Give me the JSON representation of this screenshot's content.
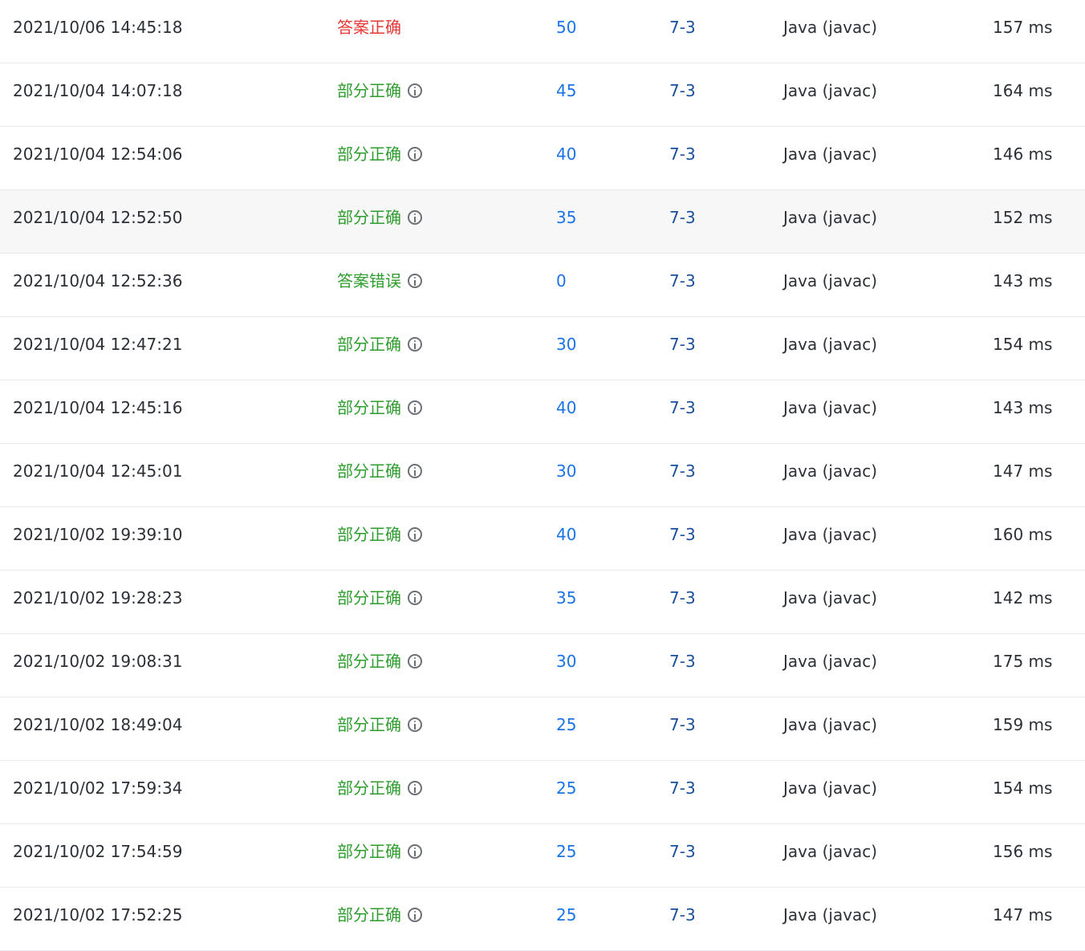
{
  "submissions": [
    {
      "submitted": "2021/10/06 14:45:18",
      "status": "答案正确",
      "status_type": "ok",
      "score": "50",
      "problem": "7-3",
      "language": "Java (javac)",
      "runtime": "157 ms"
    },
    {
      "submitted": "2021/10/04 14:07:18",
      "status": "部分正确",
      "status_type": "partial",
      "score": "45",
      "problem": "7-3",
      "language": "Java (javac)",
      "runtime": "164 ms"
    },
    {
      "submitted": "2021/10/04 12:54:06",
      "status": "部分正确",
      "status_type": "partial",
      "score": "40",
      "problem": "7-3",
      "language": "Java (javac)",
      "runtime": "146 ms"
    },
    {
      "submitted": "2021/10/04 12:52:50",
      "status": "部分正确",
      "status_type": "partial",
      "score": "35",
      "problem": "7-3",
      "language": "Java (javac)",
      "runtime": "152 ms"
    },
    {
      "submitted": "2021/10/04 12:52:36",
      "status": "答案错误",
      "status_type": "wrong",
      "score": "0",
      "problem": "7-3",
      "language": "Java (javac)",
      "runtime": "143 ms"
    },
    {
      "submitted": "2021/10/04 12:47:21",
      "status": "部分正确",
      "status_type": "partial",
      "score": "30",
      "problem": "7-3",
      "language": "Java (javac)",
      "runtime": "154 ms"
    },
    {
      "submitted": "2021/10/04 12:45:16",
      "status": "部分正确",
      "status_type": "partial",
      "score": "40",
      "problem": "7-3",
      "language": "Java (javac)",
      "runtime": "143 ms"
    },
    {
      "submitted": "2021/10/04 12:45:01",
      "status": "部分正确",
      "status_type": "partial",
      "score": "30",
      "problem": "7-3",
      "language": "Java (javac)",
      "runtime": "147 ms"
    },
    {
      "submitted": "2021/10/02 19:39:10",
      "status": "部分正确",
      "status_type": "partial",
      "score": "40",
      "problem": "7-3",
      "language": "Java (javac)",
      "runtime": "160 ms"
    },
    {
      "submitted": "2021/10/02 19:28:23",
      "status": "部分正确",
      "status_type": "partial",
      "score": "35",
      "problem": "7-3",
      "language": "Java (javac)",
      "runtime": "142 ms"
    },
    {
      "submitted": "2021/10/02 19:08:31",
      "status": "部分正确",
      "status_type": "partial",
      "score": "30",
      "problem": "7-3",
      "language": "Java (javac)",
      "runtime": "175 ms"
    },
    {
      "submitted": "2021/10/02 18:49:04",
      "status": "部分正确",
      "status_type": "partial",
      "score": "25",
      "problem": "7-3",
      "language": "Java (javac)",
      "runtime": "159 ms"
    },
    {
      "submitted": "2021/10/02 17:59:34",
      "status": "部分正确",
      "status_type": "partial",
      "score": "25",
      "problem": "7-3",
      "language": "Java (javac)",
      "runtime": "154 ms"
    },
    {
      "submitted": "2021/10/02 17:54:59",
      "status": "部分正确",
      "status_type": "partial",
      "score": "25",
      "problem": "7-3",
      "language": "Java (javac)",
      "runtime": "156 ms"
    },
    {
      "submitted": "2021/10/02 17:52:25",
      "status": "部分正确",
      "status_type": "partial",
      "score": "25",
      "problem": "7-3",
      "language": "Java (javac)",
      "runtime": "147 ms"
    }
  ],
  "hovered_row": 3,
  "icons": {
    "detail": "info-icon"
  },
  "colors": {
    "ok": "#e53935",
    "partial": "#2e9d2e",
    "wrong": "#2e9d2e",
    "score_link": "#1a73e8",
    "problem_link": "#1b4f9c"
  }
}
